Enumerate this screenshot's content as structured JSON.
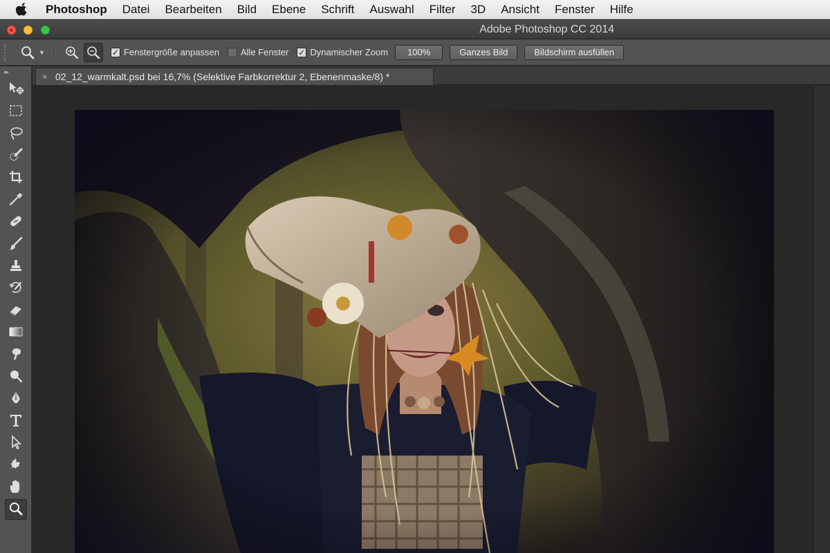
{
  "menubar": {
    "app_name": "Photoshop",
    "items": [
      "Datei",
      "Bearbeiten",
      "Bild",
      "Ebene",
      "Schrift",
      "Auswahl",
      "Filter",
      "3D",
      "Ansicht",
      "Fenster",
      "Hilfe"
    ]
  },
  "window": {
    "title": "Adobe Photoshop CC 2014"
  },
  "options": {
    "resize_windows_label": "Fenstergröße anpassen",
    "resize_windows_checked": true,
    "all_windows_label": "Alle Fenster",
    "all_windows_checked": false,
    "scrubby_zoom_label": "Dynamischer Zoom",
    "scrubby_zoom_checked": true,
    "btn_100": "100%",
    "btn_fit": "Ganzes Bild",
    "btn_fill": "Bildschirm ausfüllen"
  },
  "document": {
    "tab_title": "02_12_warmkalt.psd bei 16,7% (Selektive Farbkorrektur 2, Ebenenmaske/8) *",
    "close_glyph": "×"
  },
  "tools": [
    {
      "icon": "move-icon",
      "active": false
    },
    {
      "icon": "marquee-icon",
      "active": false
    },
    {
      "icon": "lasso-icon",
      "active": false
    },
    {
      "icon": "quick-selection-icon",
      "active": false
    },
    {
      "icon": "crop-icon",
      "active": false
    },
    {
      "icon": "eyedropper-icon",
      "active": false
    },
    {
      "icon": "healing-brush-icon",
      "active": false
    },
    {
      "icon": "brush-icon",
      "active": false
    },
    {
      "icon": "clone-stamp-icon",
      "active": false
    },
    {
      "icon": "history-brush-icon",
      "active": false
    },
    {
      "icon": "eraser-icon",
      "active": false
    },
    {
      "icon": "gradient-icon",
      "active": false
    },
    {
      "icon": "smudge-icon",
      "active": false
    },
    {
      "icon": "dodge-icon",
      "active": false
    },
    {
      "icon": "pen-icon",
      "active": false
    },
    {
      "icon": "type-icon",
      "active": false
    },
    {
      "icon": "path-selection-icon",
      "active": false
    },
    {
      "icon": "custom-shape-icon",
      "active": false
    },
    {
      "icon": "hand-icon",
      "active": false
    },
    {
      "icon": "zoom-icon",
      "active": true
    }
  ],
  "colors": {
    "menubar_bg": "#e8e8e8",
    "panel_bg": "#535353",
    "canvas_bg": "#282828",
    "accent_red": "#fc5753",
    "accent_yellow": "#fdbc40",
    "accent_green": "#33c748"
  }
}
